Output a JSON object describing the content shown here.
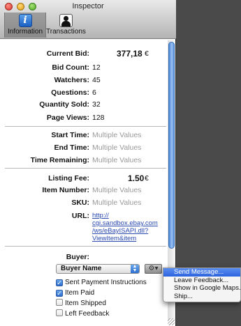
{
  "window": {
    "title": "Inspector"
  },
  "toolbar": {
    "info_label": "Information",
    "info_glyph": "i",
    "trans_label": "Transactions"
  },
  "currency": "€",
  "stats": {
    "current_bid_label": "Current Bid:",
    "current_bid_value": "377,18",
    "bid_count_label": "Bid Count:",
    "bid_count_value": "12",
    "watchers_label": "Watchers:",
    "watchers_value": "45",
    "questions_label": "Questions:",
    "questions_value": "6",
    "qty_sold_label": "Quantity Sold:",
    "qty_sold_value": "32",
    "page_views_label": "Page Views:",
    "page_views_value": "128"
  },
  "times": {
    "start_label": "Start Time:",
    "start_value": "Multiple Values",
    "end_label": "End Time:",
    "end_value": "Multiple Values",
    "remaining_label": "Time Remaining:",
    "remaining_value": "Multiple Values"
  },
  "listing": {
    "fee_label": "Listing Fee:",
    "fee_value": "1.50",
    "item_number_label": "Item Number:",
    "item_number_value": "Multiple Values",
    "sku_label": "SKU:",
    "sku_value": "Multiple Values",
    "url_label": "URL:",
    "url_lines": [
      "http://",
      "cgi.sandbox.ebay.com",
      "/ws/eBayISAPI.dll?",
      "ViewItem&item"
    ]
  },
  "buyer": {
    "label": "Buyer:",
    "popup_value": "Buyer Name",
    "gear_glyph": "⚙▾",
    "checks": [
      {
        "label": "Sent Payment Instructions",
        "checked": true
      },
      {
        "label": "Item Paid",
        "checked": true
      },
      {
        "label": "Item Shipped",
        "checked": false
      },
      {
        "label": "Left Feedback",
        "checked": false
      }
    ]
  },
  "menu": {
    "items": [
      "Send Message...",
      "Leave Feedback...",
      "Show in Google Maps...",
      "Ship..."
    ],
    "highlighted_index": 0
  },
  "colors": {
    "accent": "#2b63de",
    "link": "#2a4ab0"
  }
}
